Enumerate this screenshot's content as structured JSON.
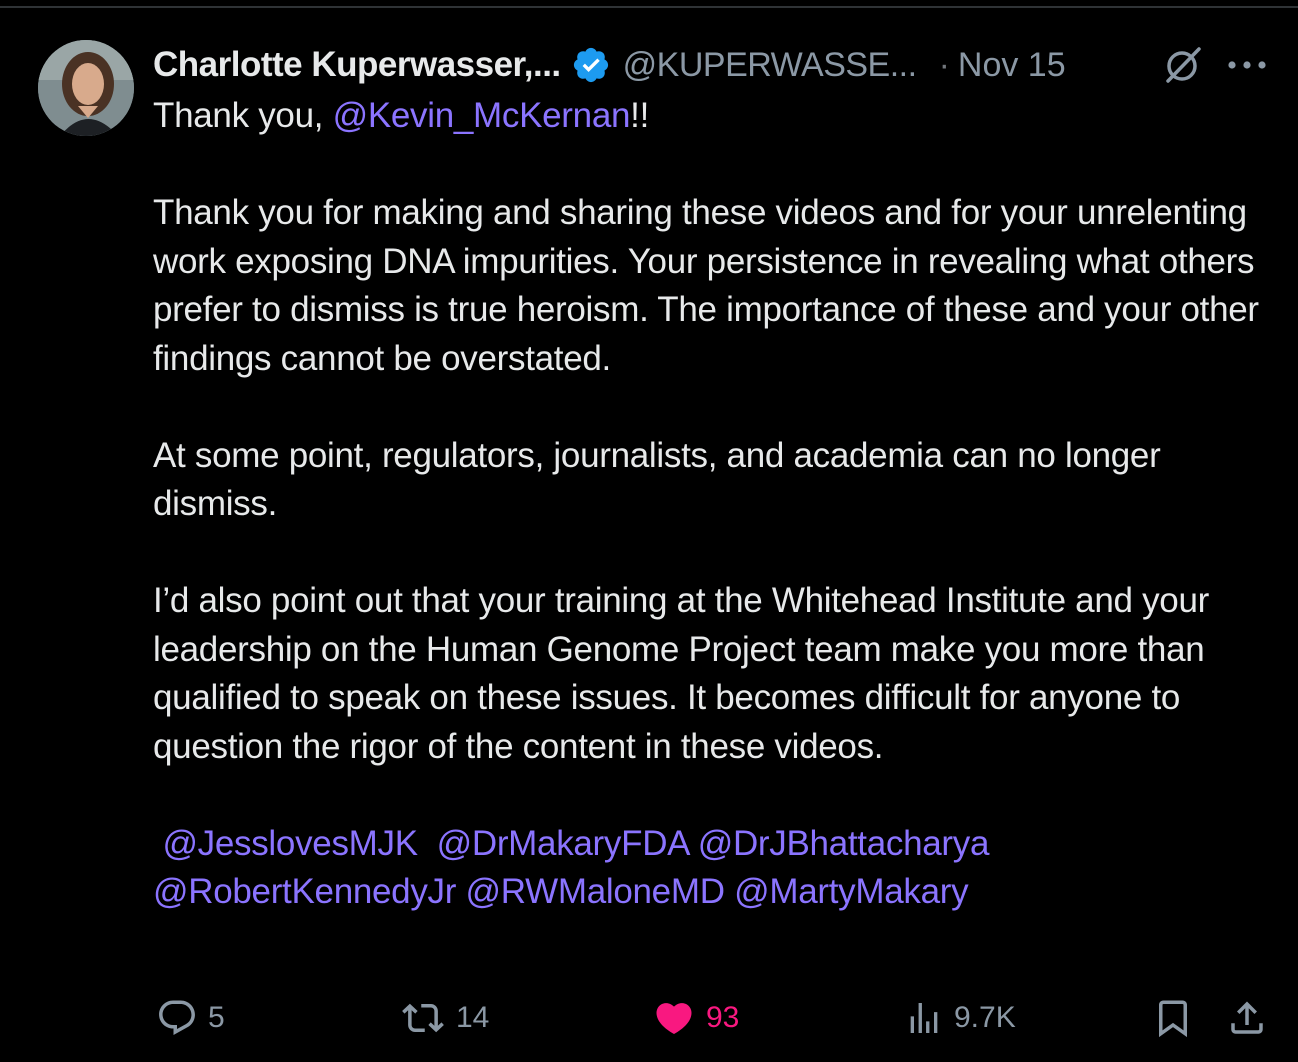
{
  "tweet": {
    "author_name": "Charlotte Kuperwasser,...",
    "handle": "@KUPERWASSE...",
    "separator": "·",
    "date": "Nov 15",
    "line1_prefix": "Thank you, ",
    "line1_mention": "@Kevin_McKernan",
    "line1_suffix": "!!",
    "para2": "Thank you for making and sharing these videos and for your unrelenting work exposing DNA impurities. Your persistence in revealing what others prefer to dismiss is true heroism. The importance of these and your other findings cannot be overstated.",
    "para3": "At some point, regulators, journalists, and academia can no longer dismiss.",
    "para4": "I’d also point out that your training at the Whitehead Institute and your leadership on the Human Genome Project team make you more than qualified to speak on these issues. It becomes difficult for anyone to question the rigor of the content in these videos.",
    "mentions": [
      "@JesslovesMJK",
      "@DrMakaryFDA",
      "@DrJBhattacharya",
      "@RobertKennedyJr",
      "@RWMaloneMD",
      "@MartyMakary"
    ]
  },
  "actions": {
    "replies": "5",
    "reposts": "14",
    "likes": "93",
    "views": "9.7K"
  },
  "colors": {
    "background": "#000000",
    "text": "#e7e9ea",
    "muted": "#8b98a5",
    "mention": "#8b74ff",
    "like": "#f91880",
    "verified": "#1d9bf0"
  },
  "icons": [
    "avatar",
    "verified-badge-icon",
    "grok-icon",
    "more-icon",
    "reply-icon",
    "repost-icon",
    "heart-icon",
    "views-icon",
    "bookmark-icon",
    "share-icon"
  ]
}
